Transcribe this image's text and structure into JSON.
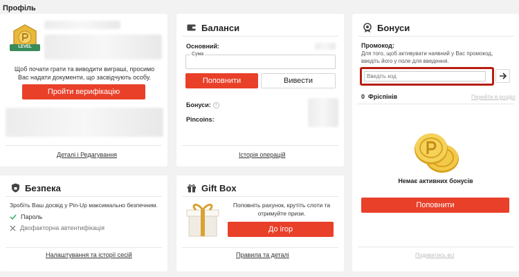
{
  "page": {
    "title": "Профіль"
  },
  "profile": {
    "verify_text": "Щоб почати грати та виводити виграші, просимо Вас надати документи, що засвідчують особу.",
    "verify_button": "Пройти верифікацію",
    "details_link": "Деталі і Редагування",
    "badge_text": "LEVEL"
  },
  "balances": {
    "title": "Баланси",
    "main_label": "Основний:",
    "amount_label": "Сума",
    "deposit_button": "Поповнити",
    "withdraw_button": "Вивести",
    "bonuses_label": "Бонуси:",
    "pincoins_label": "Pincoins:",
    "history_link": "Історія операцій"
  },
  "bonuses": {
    "title": "Бонуси",
    "promo_label": "Промокод:",
    "promo_hint": "Для того, щоб активувати наявний у Вас промокод, введіть його у поле для введення.",
    "promo_placeholder": "Введіть код",
    "freespins_count": "0",
    "freespins_label": "Фріспінів",
    "goto_link": "Перейти в розділ",
    "empty_text": "Немає активних бонусів",
    "deposit_button": "Поповнити",
    "view_all_link": "Подивитись всі"
  },
  "security": {
    "title": "Безпека",
    "description": "Зробіть Ваш досвід у Pin-Up максимально безпечним.",
    "items": [
      {
        "label": "Пароль",
        "status": "done"
      },
      {
        "label": "Двофакторна автентифікація",
        "status": "off"
      }
    ],
    "settings_link": "Налаштування та історії сесій"
  },
  "giftbox": {
    "title": "Gift Box",
    "description": "Поповніть рахунок, крутіть слоти та отримуйте призи.",
    "games_button": "До ігор",
    "rules_link": "Правила та деталі"
  },
  "colors": {
    "accent": "#e9402a",
    "highlight": "#b71d10",
    "check": "#3cb371"
  }
}
